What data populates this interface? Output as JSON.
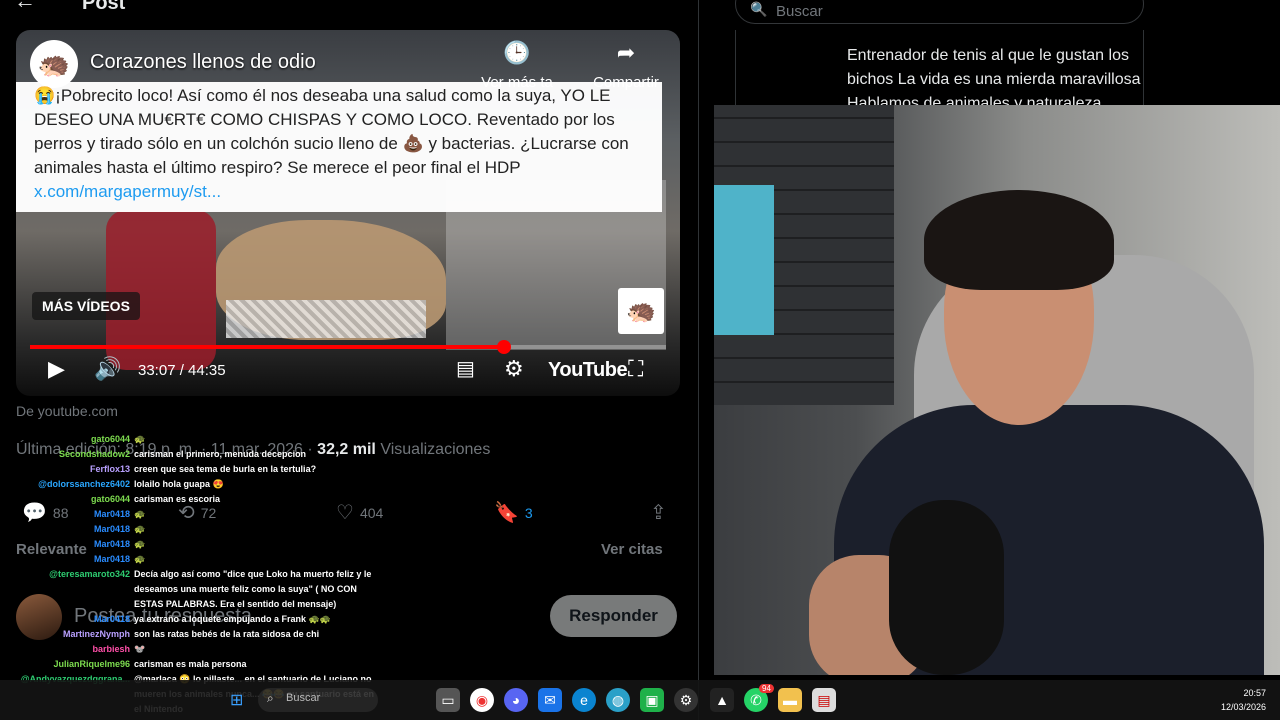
{
  "x_post": {
    "header_title": "Post",
    "embed": {
      "channel_title": "Corazones llenos de odio",
      "watch_later_label": "Ver más ta",
      "share_label": "Compartir",
      "tweet_text": "😭¡Pobrecito loco! Así como él nos deseaba una salud como la suya, YO LE DESEO UNA MU€RT€ COMO CHISPAS Y COMO LOCO. Reventado por los perros y tirado sólo en un colchón sucio lleno de 💩 y bacterias. ¿Lucrarse con animales hasta el último respiro? Se merece el peor final el HDP ",
      "tweet_link": "x.com/margapermuy/st...",
      "more_videos_label": "MÁS VÍDEOS",
      "time_display": "33:07 / 44:35",
      "progress_fraction": 0.745,
      "brand": "YouTube"
    },
    "source": "De youtube.com",
    "meta_prefix": "Última edición: 8:19 p. m. · 11 mar. 2026 · ",
    "views_count": "32,2 mil",
    "views_label": "Visualizaciones",
    "actions": {
      "replies": "88",
      "reposts": "72",
      "likes": "404",
      "bookmarks": "3"
    },
    "relevant_label": "Relevante",
    "quotes_label": "Ver citas",
    "reply_placeholder": "Postea tu respuesta",
    "reply_button": "Responder"
  },
  "chat": [
    {
      "user": "gato6044",
      "color": "#7ddc4f",
      "msg": "🐢"
    },
    {
      "user": "Secondshadow2",
      "color": "#7ddc4f",
      "msg": "carisman el primero, menuda decepcion"
    },
    {
      "user": "Ferflox13",
      "color": "#b9a0ff",
      "msg": "creen que sea tema de burla en la tertulia?"
    },
    {
      "user": "@dolorssanchez6402",
      "color": "#2aa7ff",
      "msg": "lolailo hola guapa 😍"
    },
    {
      "user": "gato6044",
      "color": "#7ddc4f",
      "msg": "carisman es escoria"
    },
    {
      "user": "Mar0418",
      "color": "#2a8cff",
      "msg": "🐢"
    },
    {
      "user": "Mar0418",
      "color": "#2a8cff",
      "msg": "🐢"
    },
    {
      "user": "Mar0418",
      "color": "#2a8cff",
      "msg": "🐢"
    },
    {
      "user": "Mar0418",
      "color": "#2a8cff",
      "msg": "🐢"
    },
    {
      "user": "@teresamaroto342",
      "color": "#2ecc71",
      "msg": "Decía algo así como \"dice que Loko ha muerto feliz y le deseamos una muerte feliz como la suya\" ( NO CON ESTAS PALABRAS. Era el sentido del mensaje)"
    },
    {
      "user": "Mar0418",
      "color": "#2a8cff",
      "msg": "ya extraño a loquete empujando a Frank 🐢🐢"
    },
    {
      "user": "MartinezNymph",
      "color": "#b9a0ff",
      "msg": "son las ratas bebés de la rata sidosa de chi"
    },
    {
      "user": "barbiesh",
      "color": "#ff4fa8",
      "msg": "🐭"
    },
    {
      "user": "JulianRiquelme96",
      "color": "#7ddc4f",
      "msg": "carisman es mala persona"
    },
    {
      "user": "@Andyvazquezdggrana...",
      "color": "#2ecc71",
      "msg": "@marlaca 😳 lo pillaste... en el santuario de Luciano no mueren los animales nunca... 😂😂 su santuario está en el Nintendo"
    }
  ],
  "profile_snippet": {
    "search_placeholder": "Buscar",
    "bio": "Entrenador de tenis al que le gustan los bichos La vida es una mierda maravillosa Hablamos de animales y naturaleza."
  },
  "taskbar": {
    "search_placeholder": "Buscar",
    "notification_badge": "94",
    "time": "20:57",
    "date": "12/03/2026"
  }
}
